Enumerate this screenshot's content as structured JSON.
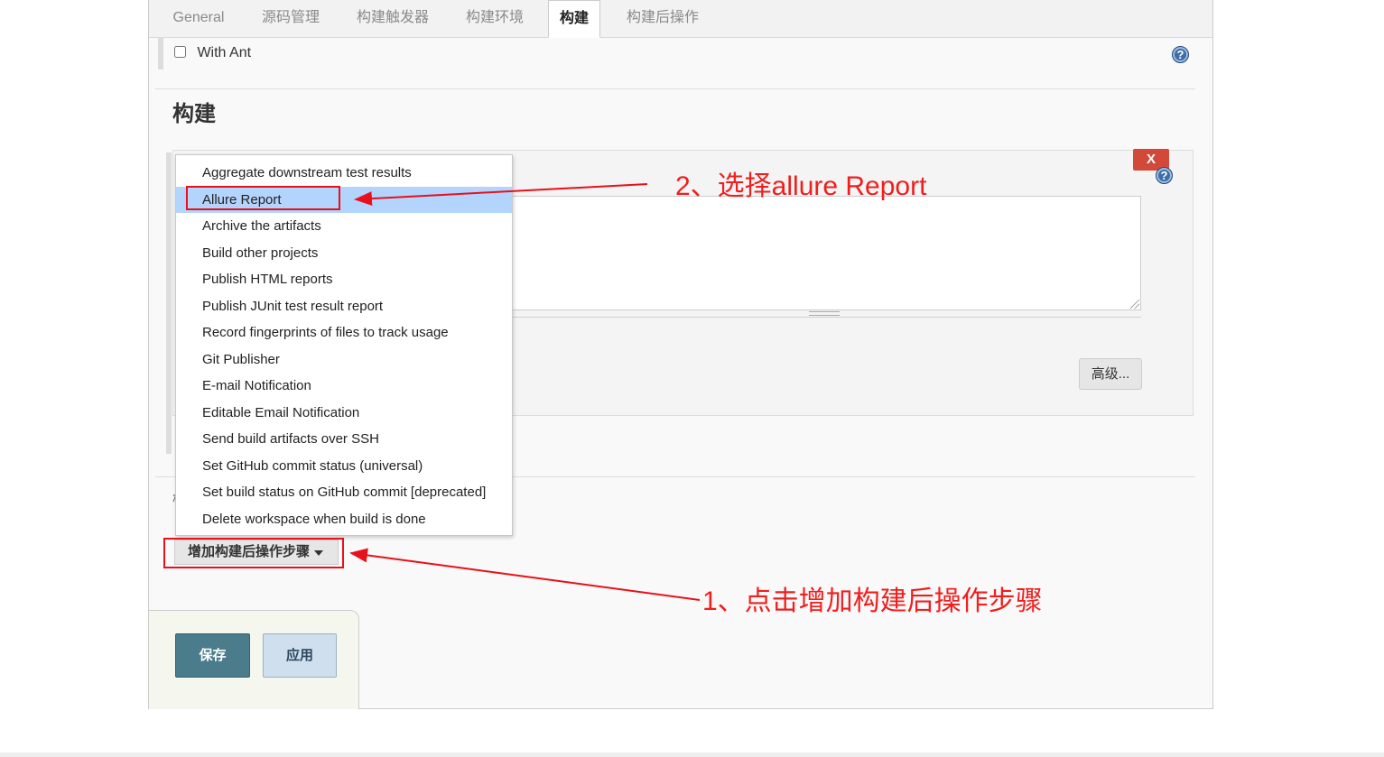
{
  "tabs": [
    {
      "label": "General"
    },
    {
      "label": "源码管理"
    },
    {
      "label": "构建触发器"
    },
    {
      "label": "构建环境"
    },
    {
      "label": "构建"
    },
    {
      "label": "构建后操作"
    }
  ],
  "active_tab": "构建",
  "with_ant": {
    "label": "With Ant",
    "checked": false
  },
  "section": {
    "title": "构建"
  },
  "build_step": {
    "delete_label": "X",
    "advanced_label": "高级..."
  },
  "help_icon_glyph": "?",
  "add_step_button": {
    "label": "增加构建后操作步骤"
  },
  "hidden_section_char": "构",
  "dropdown": {
    "items": [
      "Aggregate downstream test results",
      "Allure Report",
      "Archive the artifacts",
      "Build other projects",
      "Publish HTML reports",
      "Publish JUnit test result report",
      "Record fingerprints of files to track usage",
      "Git Publisher",
      "E-mail Notification",
      "Editable Email Notification",
      "Send build artifacts over SSH",
      "Set GitHub commit status (universal)",
      "Set build status on GitHub commit [deprecated]",
      "Delete workspace when build is done"
    ],
    "selected": "Allure Report"
  },
  "footer_buttons": {
    "save": "保存",
    "apply": "应用"
  },
  "annotations": {
    "step1": "1、点击增加构建后操作步骤",
    "step2": "2、选择allure Report",
    "color": "#e8101a"
  },
  "colors": {
    "selected_item": "#b3d4fc",
    "delete": "#d24939",
    "save": "#4a7c8c",
    "apply": "#d0dfee"
  }
}
